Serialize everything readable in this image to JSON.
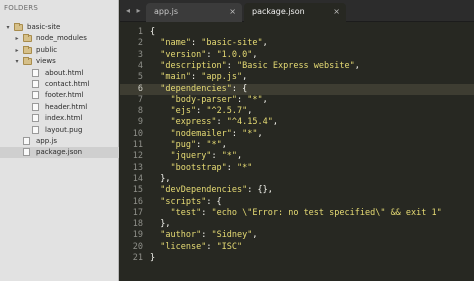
{
  "sidebar": {
    "header": "FOLDERS",
    "tree": [
      {
        "label": "basic-site",
        "kind": "folder",
        "open": true,
        "depth": 0
      },
      {
        "label": "node_modules",
        "kind": "folder",
        "open": false,
        "depth": 1
      },
      {
        "label": "public",
        "kind": "folder",
        "open": false,
        "depth": 1
      },
      {
        "label": "views",
        "kind": "folder",
        "open": true,
        "depth": 1
      },
      {
        "label": "about.html",
        "kind": "file",
        "depth": 2
      },
      {
        "label": "contact.html",
        "kind": "file",
        "depth": 2
      },
      {
        "label": "footer.html",
        "kind": "file",
        "depth": 2
      },
      {
        "label": "header.html",
        "kind": "file",
        "depth": 2
      },
      {
        "label": "index.html",
        "kind": "file",
        "depth": 2
      },
      {
        "label": "layout.pug",
        "kind": "file",
        "depth": 2
      },
      {
        "label": "app.js",
        "kind": "file",
        "depth": 1
      },
      {
        "label": "package.json",
        "kind": "file",
        "depth": 1,
        "selected": true
      }
    ]
  },
  "tabs": [
    {
      "label": "app.js",
      "active": false
    },
    {
      "label": "package.json",
      "active": true
    }
  ],
  "tab_arrows": "◂ ▸",
  "editor": {
    "highlighted_line": 6,
    "lines": [
      "{",
      "  \"name\": \"basic-site\",",
      "  \"version\": \"1.0.0\",",
      "  \"description\": \"Basic Express website\",",
      "  \"main\": \"app.js\",",
      "  \"dependencies\": {",
      "    \"body-parser\": \"*\",",
      "    \"ejs\": \"^2.5.7\",",
      "    \"express\": \"^4.15.4\",",
      "    \"nodemailer\": \"*\",",
      "    \"pug\": \"*\",",
      "    \"jquery\": \"*\",",
      "    \"bootstrap\": \"*\"",
      "  },",
      "  \"devDependencies\": {},",
      "  \"scripts\": {",
      "    \"test\": \"echo \\\"Error: no test specified\\\" && exit 1\"",
      "  },",
      "  \"author\": \"Sidney\",",
      "  \"license\": \"ISC\"",
      "}"
    ]
  },
  "colors": {
    "editor_bg": "#272822",
    "string": "#e6db74",
    "punct": "#f8f8f2",
    "line_number": "#8f908a",
    "sidebar_bg": "#e2e2e2"
  },
  "icons": {
    "close": "close-icon",
    "folder": "folder-icon",
    "file": "file-icon"
  },
  "close_glyph": "×"
}
